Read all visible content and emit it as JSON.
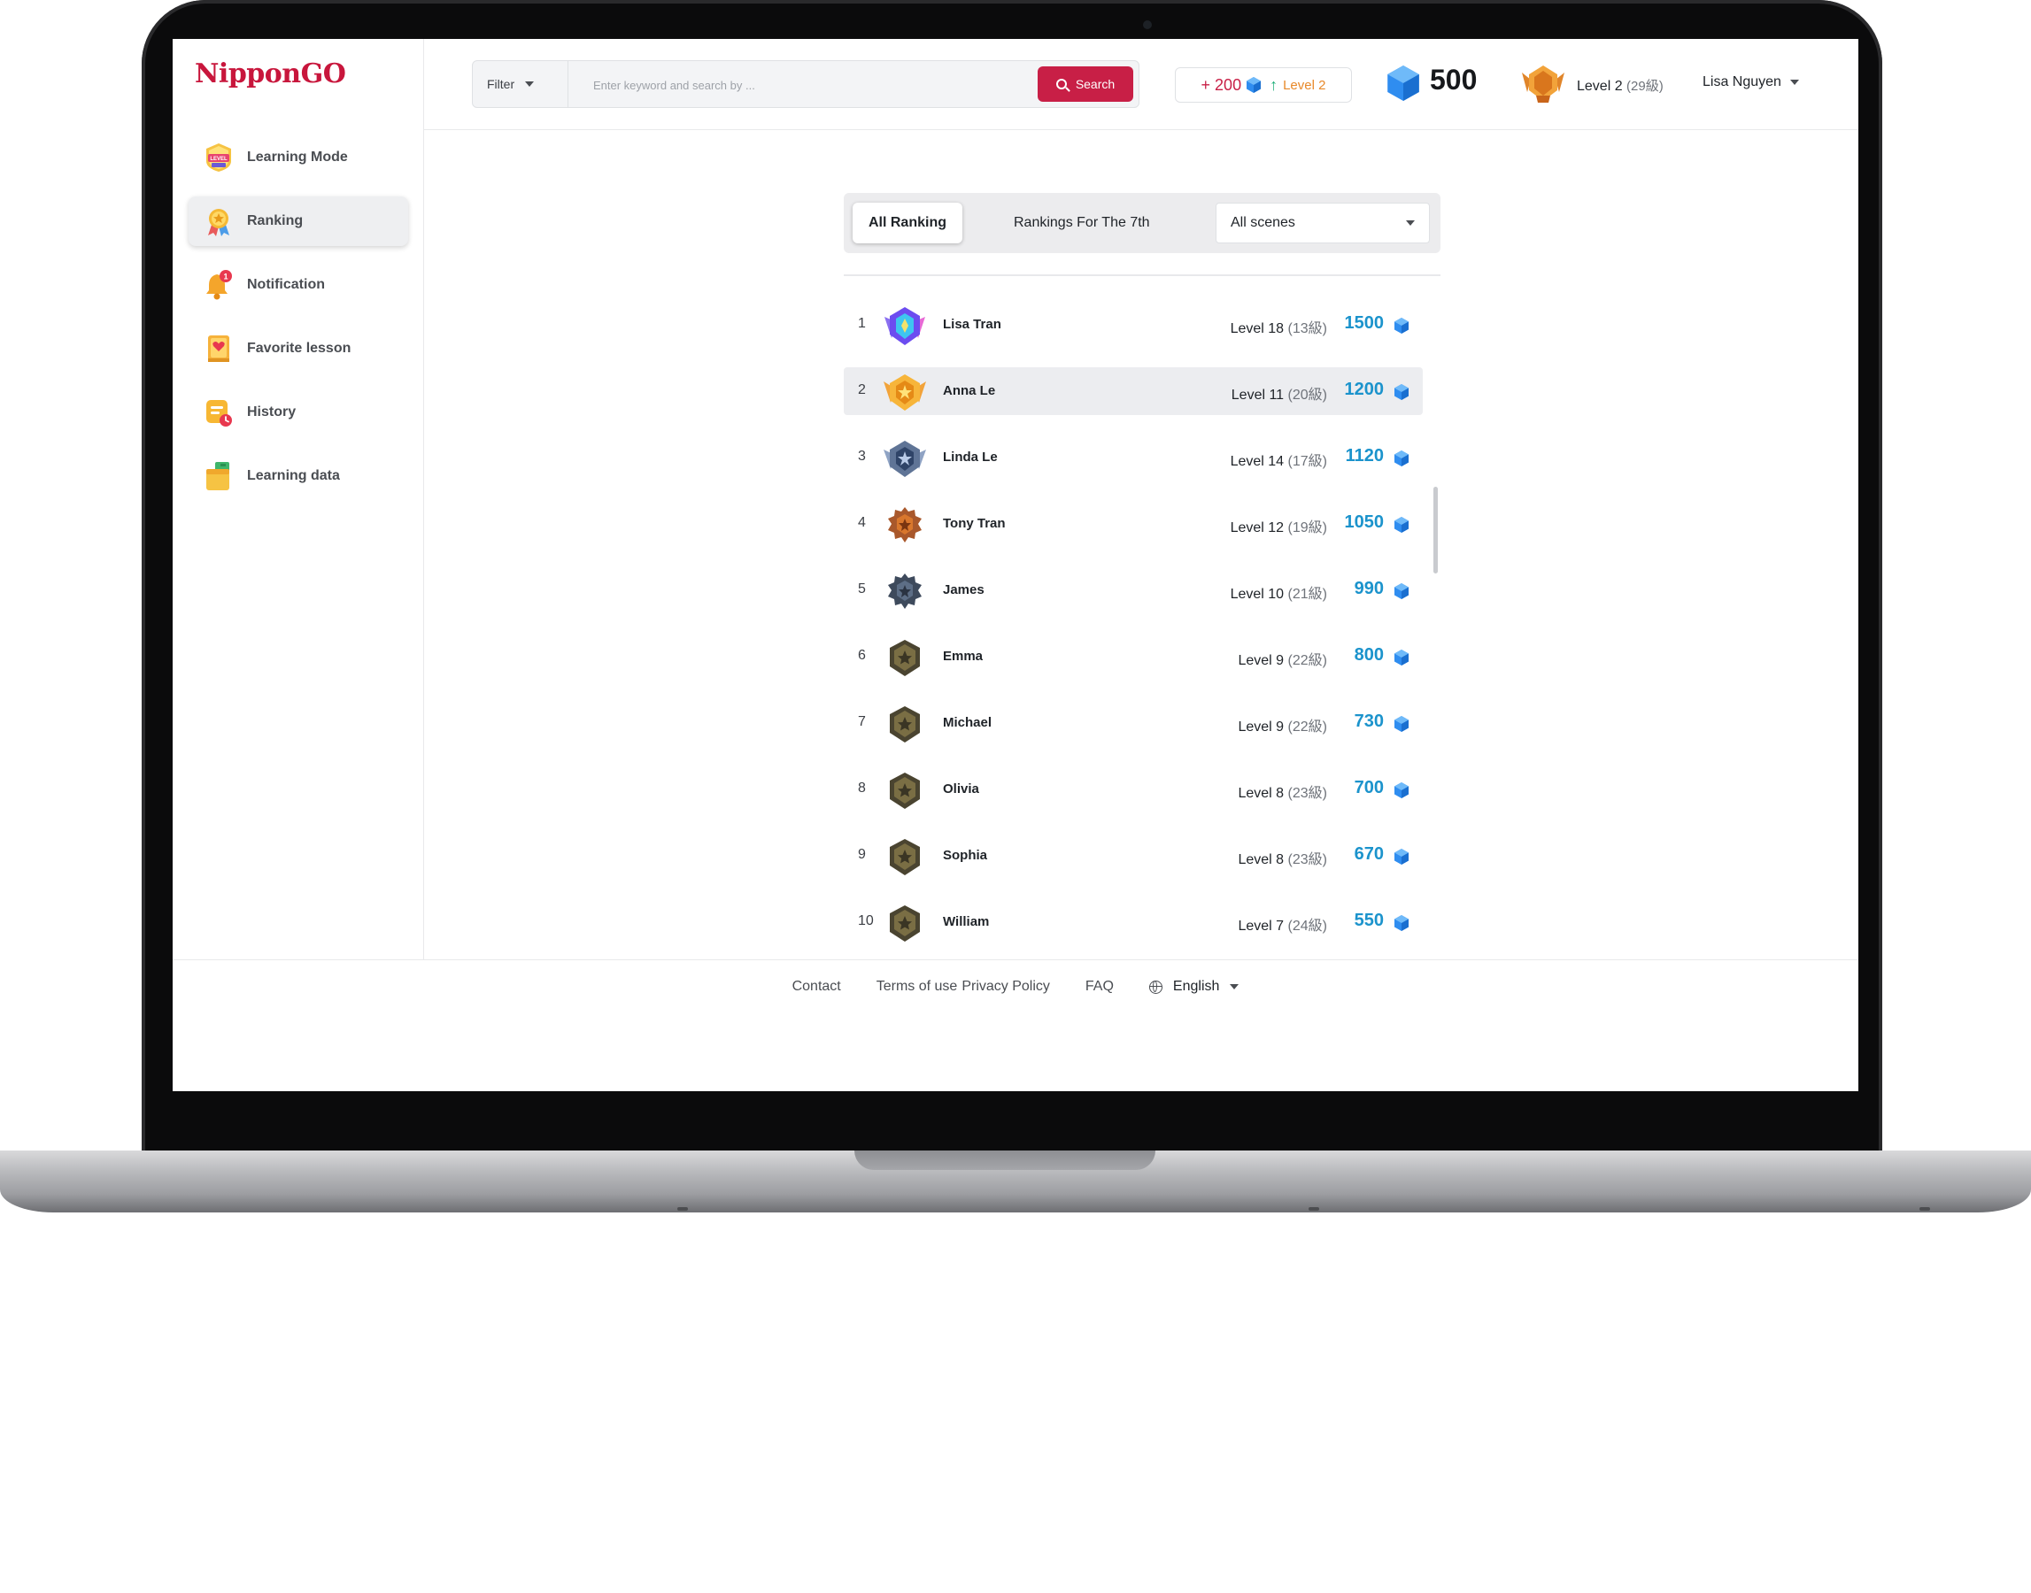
{
  "app": {
    "logo": "NipponGO"
  },
  "sidebar": {
    "items": [
      {
        "label": "Learning Mode",
        "icon": "level-up-icon"
      },
      {
        "label": "Ranking",
        "icon": "ranking-medal-icon",
        "active": true
      },
      {
        "label": "Notification",
        "icon": "bell-icon",
        "badge": "1"
      },
      {
        "label": "Favorite lesson",
        "icon": "favorite-book-icon"
      },
      {
        "label": "History",
        "icon": "history-icon"
      },
      {
        "label": "Learning data",
        "icon": "learning-data-icon"
      }
    ]
  },
  "header": {
    "filter_label": "Filter",
    "search_placeholder": "Enter keyword and search by ...",
    "search_button": "Search",
    "reward_points": "+ 200",
    "reward_level": "Level 2",
    "gem_count": "500",
    "user_level": "Level 2",
    "user_kyu": "(29級)",
    "user_name": "Lisa Nguyen"
  },
  "ranking": {
    "tab_all": "All Ranking",
    "tab_period": "Rankings For The 7th",
    "scene_select": "All scenes",
    "rows": [
      {
        "rank": "1",
        "name": "Lisa Tran",
        "level": "Level 18",
        "kyu": "(13級)",
        "score": "1500",
        "medal": "diamond-medal-icon"
      },
      {
        "rank": "2",
        "name": "Anna Le",
        "level": "Level 11",
        "kyu": "(20級)",
        "score": "1200",
        "medal": "gold-medal-icon",
        "highlight": true
      },
      {
        "rank": "3",
        "name": "Linda Le",
        "level": "Level 14",
        "kyu": "(17級)",
        "score": "1120",
        "medal": "platinum-medal-icon"
      },
      {
        "rank": "4",
        "name": "Tony Tran",
        "level": "Level 12",
        "kyu": "(19級)",
        "score": "1050",
        "medal": "bronze-medal-icon"
      },
      {
        "rank": "5",
        "name": "James",
        "level": "Level 10",
        "kyu": "(21級)",
        "score": "990",
        "medal": "steel-medal-icon"
      },
      {
        "rank": "6",
        "name": "Emma",
        "level": "Level 9",
        "kyu": "(22級)",
        "score": "800",
        "medal": "iron-medal-icon"
      },
      {
        "rank": "7",
        "name": "Michael",
        "level": "Level 9",
        "kyu": "(22級)",
        "score": "730",
        "medal": "iron-medal-icon"
      },
      {
        "rank": "8",
        "name": "Olivia",
        "level": "Level 8",
        "kyu": "(23級)",
        "score": "700",
        "medal": "iron-medal-icon"
      },
      {
        "rank": "9",
        "name": "Sophia",
        "level": "Level 8",
        "kyu": "(23級)",
        "score": "670",
        "medal": "iron-medal-icon"
      },
      {
        "rank": "10",
        "name": "William",
        "level": "Level 7",
        "kyu": "(24級)",
        "score": "550",
        "medal": "iron-medal-icon"
      }
    ]
  },
  "footer": {
    "contact": "Contact",
    "terms": "Terms of use",
    "privacy": "Privacy Policy",
    "faq": "FAQ",
    "language": "English"
  },
  "colors": {
    "brand": "#c8163c",
    "search_button": "#c81f46",
    "score": "#1b93cc",
    "gem": "#2f8df0",
    "reward_level": "#e8892a",
    "active_nav": "#eeeff1"
  }
}
